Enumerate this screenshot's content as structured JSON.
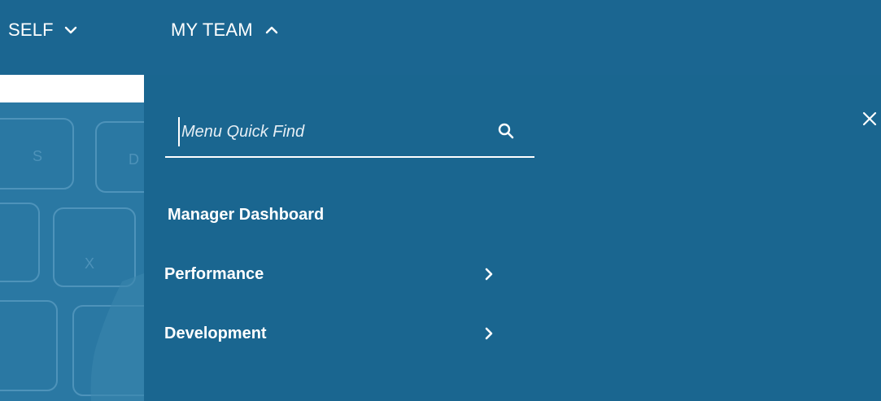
{
  "topnav": {
    "self_label": "SELF",
    "team_label": "MY TEAM"
  },
  "search": {
    "placeholder": "Menu Quick Find",
    "value": ""
  },
  "menu": {
    "items": [
      {
        "label": "Manager Dashboard",
        "has_submenu": false
      },
      {
        "label": "Performance",
        "has_submenu": true
      },
      {
        "label": "Development",
        "has_submenu": true
      }
    ]
  },
  "icons": {
    "self_chevron": "chevron-down-icon",
    "team_chevron": "chevron-up-icon",
    "search": "search-icon",
    "close": "close-icon",
    "submenu": "chevron-right-icon"
  },
  "colors": {
    "nav_bg": "#1b6691",
    "panel_bg": "#1a6690",
    "text": "#ffffff"
  }
}
